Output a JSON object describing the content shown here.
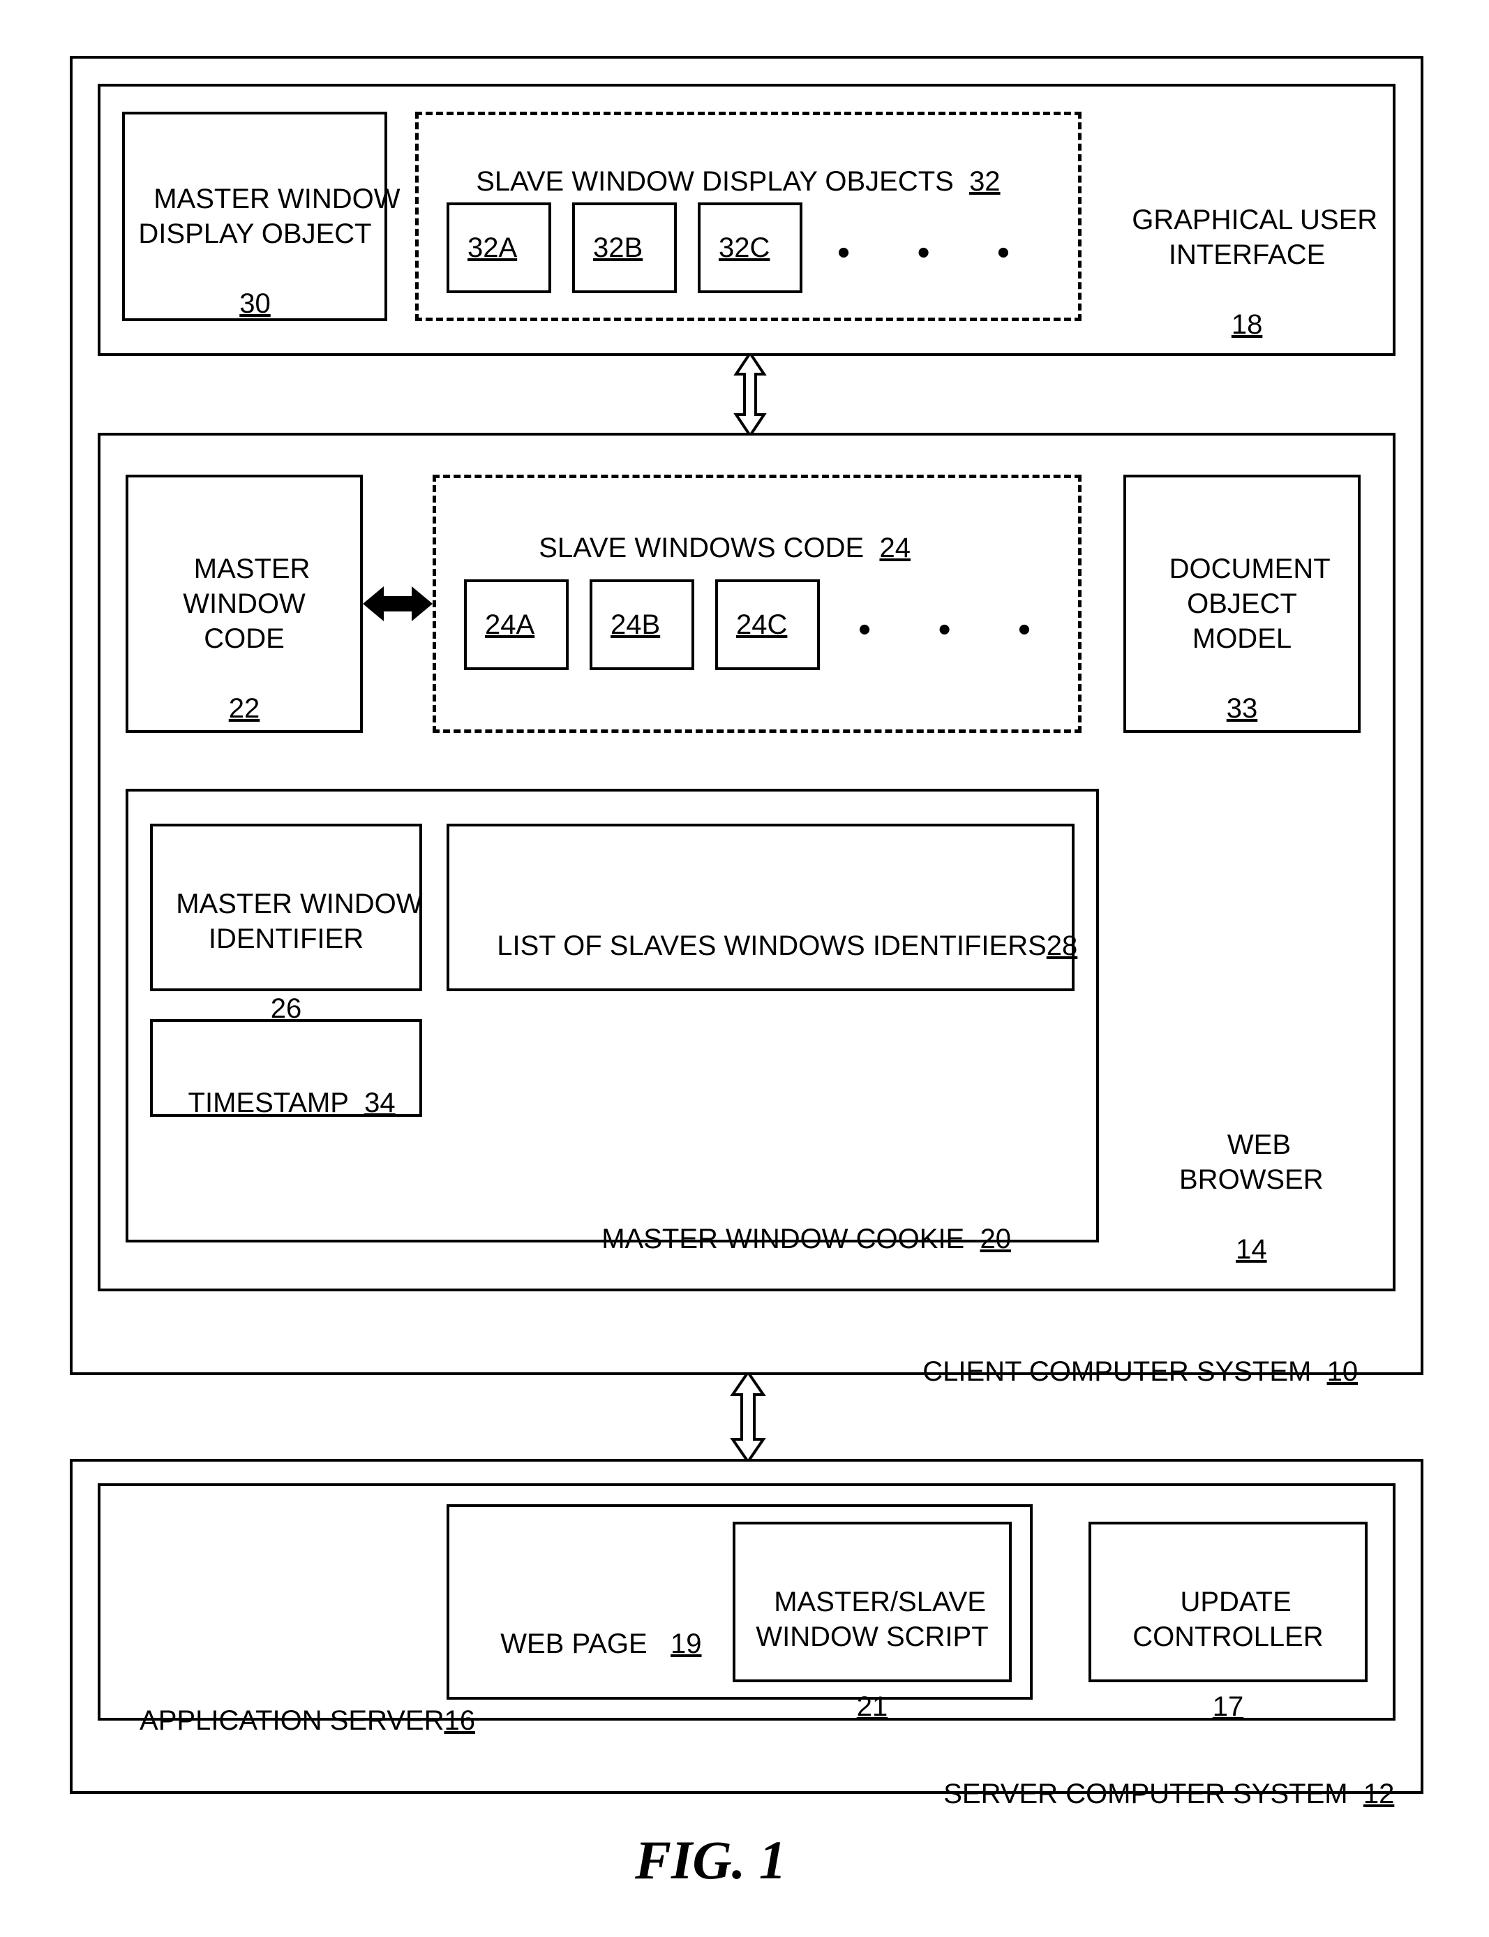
{
  "figure_caption": "FIG. 1",
  "client_system": {
    "label": "CLIENT COMPUTER SYSTEM",
    "ref": "10"
  },
  "gui": {
    "label": "GRAPHICAL USER\nINTERFACE",
    "ref": "18"
  },
  "master_window_display_object": {
    "label": "MASTER WINDOW\nDISPLAY OBJECT",
    "ref": "30"
  },
  "slave_window_display_objects": {
    "label": "SLAVE WINDOW DISPLAY OBJECTS",
    "ref": "32",
    "items": [
      "32A",
      "32B",
      "32C"
    ]
  },
  "web_browser": {
    "label": "WEB\nBROWSER",
    "ref": "14"
  },
  "dom": {
    "label": "DOCUMENT\nOBJECT\nMODEL",
    "ref": "33"
  },
  "master_window_code": {
    "label": "MASTER\nWINDOW\nCODE",
    "ref": "22"
  },
  "slave_windows_code": {
    "label": "SLAVE WINDOWS CODE",
    "ref": "24",
    "items": [
      "24A",
      "24B",
      "24C"
    ]
  },
  "master_window_identifier": {
    "label": "MASTER WINDOW\nIDENTIFIER",
    "ref": "26"
  },
  "timestamp": {
    "label": "TIMESTAMP",
    "ref": "34"
  },
  "list_slave_ids": {
    "label": "LIST OF SLAVES WINDOWS IDENTIFIERS",
    "ref": "28"
  },
  "master_window_cookie": {
    "label": "MASTER WINDOW COOKIE",
    "ref": "20"
  },
  "server_system": {
    "label": "SERVER COMPUTER SYSTEM",
    "ref": "12"
  },
  "application_server": {
    "label": "APPLICATION SERVER",
    "ref": "16"
  },
  "web_page": {
    "label": "WEB PAGE",
    "ref": "19"
  },
  "ms_script": {
    "label": "MASTER/SLAVE\nWINDOW SCRIPT",
    "ref": "21"
  },
  "update_controller": {
    "label": "UPDATE\nCONTROLLER",
    "ref": "17"
  },
  "ellipsis": "•     •     •"
}
